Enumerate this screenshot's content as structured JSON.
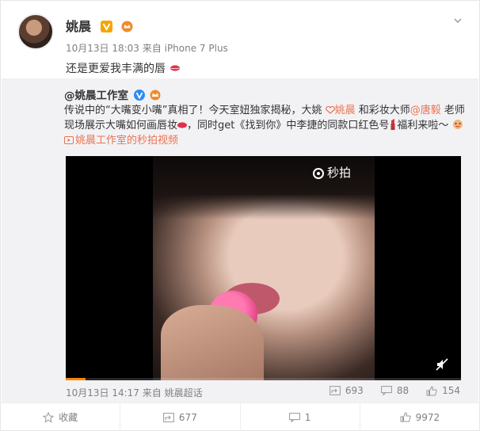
{
  "post": {
    "author": "姚晨",
    "time": "10月13日 18:03",
    "source_prefix": "来自",
    "source": "iPhone 7 Plus",
    "text": "还是更爱我丰满的唇"
  },
  "repost": {
    "author": "@姚晨工作室",
    "text_parts": [
      "传说中的“大嘴变小嘴”真相了！今天室妞独家揭秘，大姚 ",
      "姚晨",
      " 和彩妆大师",
      "@唐毅",
      " 老师现场展示大嘴如何画唇妆",
      "，同时get《找到你》中李捷的同款口红色号",
      "福利来啦～",
      "姚晨工作室的秒拍视频"
    ],
    "video": {
      "watermark": "秒拍",
      "progress": 0.05
    },
    "time": "10月13日 14:17",
    "source_prefix": "来自",
    "source": "姚晨超话",
    "stats": {
      "reposts": "693",
      "comments": "88",
      "likes": "154"
    }
  },
  "actions": {
    "favorite": "收藏",
    "repost": "677",
    "comment": "1",
    "like": "9972"
  },
  "colors": {
    "link": "#eb7350",
    "accent": "#ff8200",
    "muted": "#808080"
  }
}
